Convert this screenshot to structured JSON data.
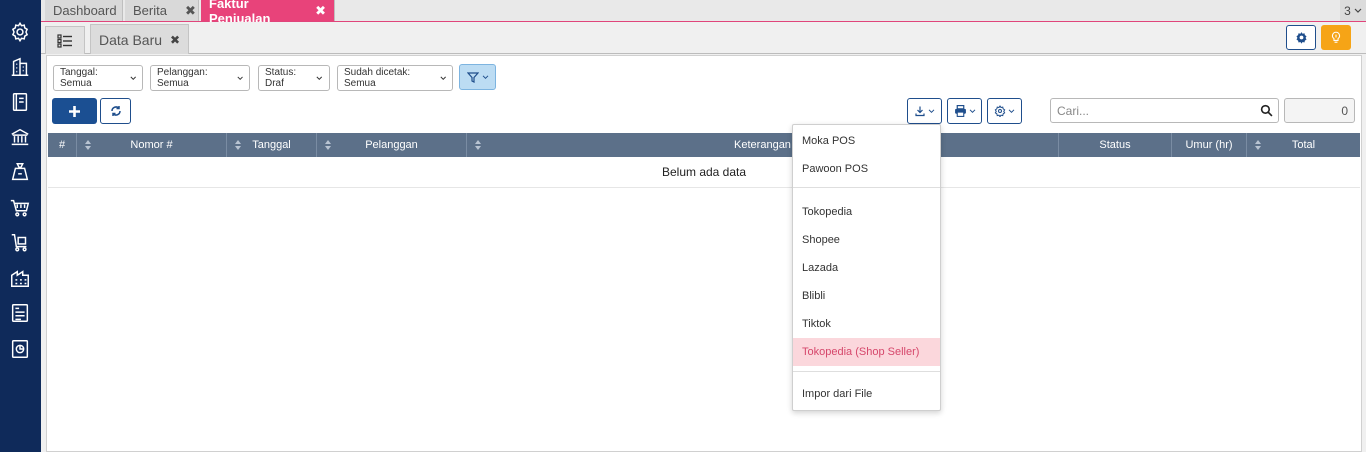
{
  "top_tabs": [
    {
      "label": "Dashboard"
    },
    {
      "label": "Berita",
      "close": "✖"
    },
    {
      "label": "Faktur Penjualan",
      "close": "✖"
    }
  ],
  "top_count": "3",
  "sub_tab": {
    "label": "Data Baru",
    "close": "✖"
  },
  "filters": {
    "tanggal": "Tanggal: Semua",
    "pelanggan": "Pelanggan: Semua",
    "status": "Status: Draf",
    "dicetak": "Sudah dicetak: Semua"
  },
  "search": {
    "placeholder": "Cari..."
  },
  "record_count": "0",
  "table": {
    "columns": [
      "#",
      "Nomor #",
      "Tanggal",
      "Pelanggan",
      "Keterangan",
      "Status",
      "Umur (hr)",
      "Total"
    ],
    "empty_message": "Belum ada data"
  },
  "import_menu": {
    "group1": [
      "Moka POS",
      "Pawoon POS"
    ],
    "group2": [
      "Tokopedia",
      "Shopee",
      "Lazada",
      "Blibli",
      "Tiktok",
      "Tokopedia (Shop Seller)"
    ],
    "group3": [
      "Impor dari File"
    ],
    "highlighted": "Tokopedia (Shop Seller)"
  },
  "colors": {
    "sidebar": "#0f2a5a",
    "active_tab": "#e8437a",
    "primary": "#1b4f92",
    "table_header": "#5c7089",
    "highlight_bg": "#fbd7dc",
    "highlight_text": "#d6476b",
    "bulb": "#f6a416"
  },
  "icons": [
    "gear-icon",
    "building-icon",
    "book-icon",
    "bank-icon",
    "money-bag-icon",
    "cart-icon",
    "delivery-cart-icon",
    "warehouse-icon",
    "tax-report-icon",
    "chart-report-icon"
  ]
}
